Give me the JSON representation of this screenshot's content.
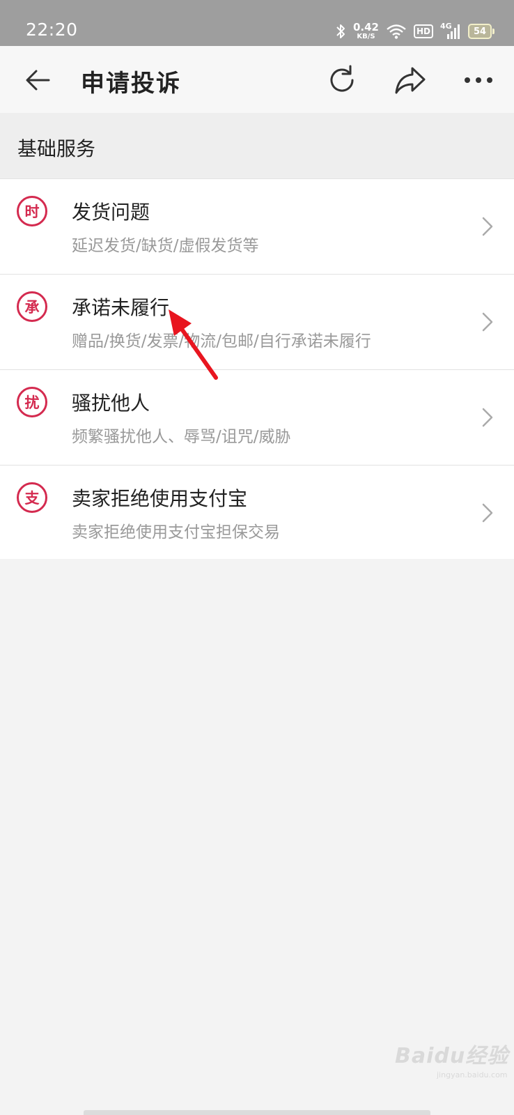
{
  "status_bar": {
    "time": "22:20",
    "net_speed_value": "0.42",
    "net_speed_unit": "KB/S",
    "hd_label": "HD",
    "network_label": "4G",
    "battery_level": "54",
    "icons": [
      "bluetooth-icon",
      "wifi-icon",
      "signal-icon",
      "battery-icon"
    ]
  },
  "app_bar": {
    "title": "申请投诉",
    "icons": [
      "back-arrow-icon",
      "refresh-icon",
      "share-icon",
      "more-icon"
    ]
  },
  "section": {
    "title": "基础服务"
  },
  "items": [
    {
      "badge": "时",
      "title": "发货问题",
      "desc": "延迟发货/缺货/虚假发货等"
    },
    {
      "badge": "承",
      "title": "承诺未履行",
      "desc": "赠品/换货/发票/物流/包邮/自行承诺未履行"
    },
    {
      "badge": "扰",
      "title": "骚扰他人",
      "desc": "频繁骚扰他人、辱骂/诅咒/威胁"
    },
    {
      "badge": "支",
      "title": "卖家拒绝使用支付宝",
      "desc": "卖家拒绝使用支付宝担保交易"
    }
  ],
  "colors": {
    "accent": "#d42a4f",
    "annotation": "#e8151f",
    "status_bar": "#9e9e9e"
  },
  "watermark": {
    "main": "Baidu经验",
    "sub": "jingyan.baidu.com"
  }
}
